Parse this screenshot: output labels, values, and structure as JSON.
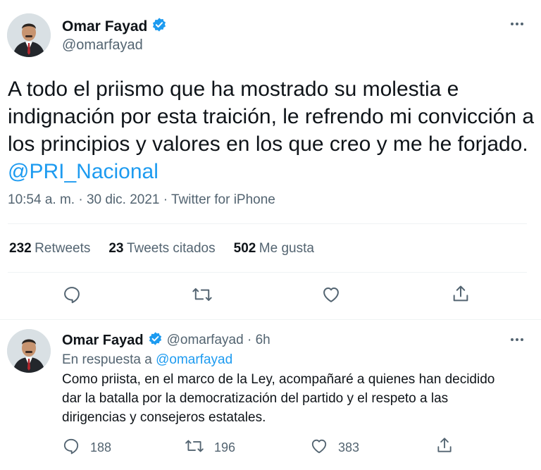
{
  "main_tweet": {
    "author_name": "Omar Fayad",
    "author_handle": "@omarfayad",
    "text": "A todo el priismo que ha mostrado su molestia e indignación por esta traición, le refrendo mi convicción a los principios y valores en los que creo y me he forjado. ",
    "mention": "@PRI_Nacional",
    "time": "10:54 a. m.",
    "date": "30 dic. 2021",
    "source": "Twitter for iPhone",
    "stats": {
      "retweets_count": "232",
      "retweets_label": "Retweets",
      "quotes_count": "23",
      "quotes_label": "Tweets citados",
      "likes_count": "502",
      "likes_label": "Me gusta"
    }
  },
  "reply_tweet": {
    "author_name": "Omar Fayad",
    "author_handle": "@omarfayad",
    "age": "6h",
    "reply_to_prefix": "En respuesta a",
    "reply_to_handle": "@omarfayad",
    "text_line1": "Como priista, en el marco de la Ley, acompañaré a quienes han decidido",
    "text_line2": "dar la batalla por la democratización del partido y el respeto a las",
    "text_line3": "dirigencias y consejeros estatales.",
    "replies": "188",
    "retweets": "196",
    "likes": "383"
  },
  "colors": {
    "accent": "#1d9bf0",
    "text": "#0f1419",
    "muted": "#536471",
    "divider": "#eff3f4"
  },
  "icons": [
    "verified-badge-icon",
    "more-icon",
    "reply-icon",
    "retweet-icon",
    "like-icon",
    "share-icon"
  ]
}
